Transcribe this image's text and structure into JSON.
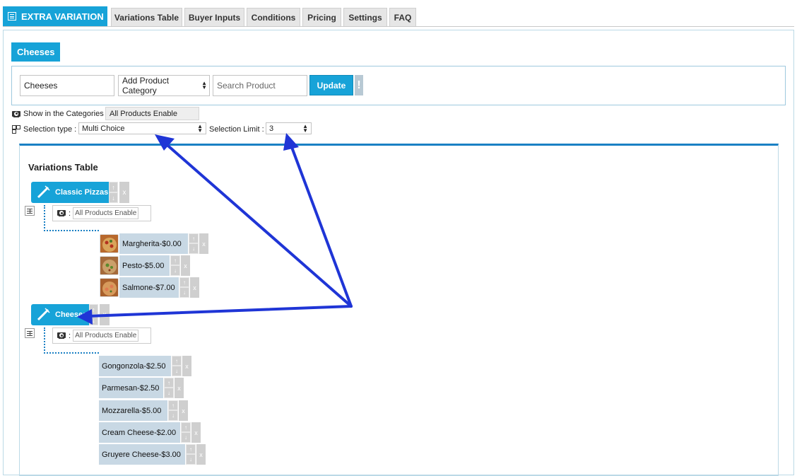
{
  "tabs": {
    "main_label": "EXTRA VARIATION",
    "items": [
      "Variations Table",
      "Buyer Inputs",
      "Conditions",
      "Pricing",
      "Settings",
      "FAQ"
    ]
  },
  "group": {
    "title": "Cheeses"
  },
  "editor": {
    "name_value": "Cheeses",
    "category_select": "Add Product Category",
    "search_placeholder": "Search Product",
    "update_label": "Update",
    "info_label": "!"
  },
  "settings": {
    "show_in_categories_label": "Show in the Categories :",
    "show_in_categories_value": "All Products Enable",
    "selection_type_label": "Selection type :",
    "selection_type_value": "Multi Choice",
    "selection_limit_label": "Selection Limit :",
    "selection_limit_value": "3"
  },
  "variations_table": {
    "title": "Variations Table",
    "categories": [
      {
        "label": "Classic Pizzas",
        "visibility_sep": ":",
        "visibility_value": "All Products Enable",
        "items": [
          {
            "label": "Margherita-$0.00"
          },
          {
            "label": "Pesto-$5.00"
          },
          {
            "label": "Salmone-$7.00"
          }
        ]
      },
      {
        "label": "Cheeses",
        "visibility_sep": ":",
        "visibility_value": "All Products Enable",
        "items": [
          {
            "label": "Gongonzola-$2.50"
          },
          {
            "label": "Parmesan-$2.50"
          },
          {
            "label": "Mozzarella-$5.00"
          },
          {
            "label": "Cream Cheese-$2.00"
          },
          {
            "label": "Gruyere Cheese-$3.00"
          }
        ]
      }
    ]
  },
  "controls": {
    "up": "↑",
    "down": "↓",
    "remove": "x"
  },
  "colors": {
    "accent": "#17a3d8",
    "annotation_arrow": "#1f35d6",
    "item_bg": "#c8d8e4"
  }
}
